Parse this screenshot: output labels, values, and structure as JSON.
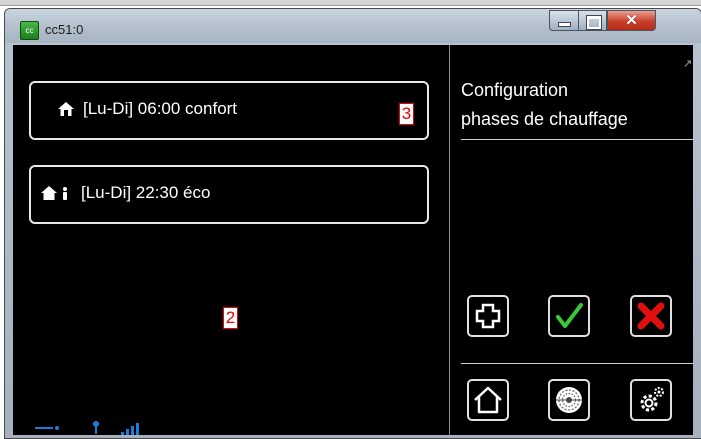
{
  "window": {
    "title": "cc51:0",
    "app_icon_label": "cc",
    "close_glyph": "✕"
  },
  "list": {
    "items": [
      {
        "text": "[Lu-Di] 06:00 confort",
        "icon": "home-icon"
      },
      {
        "text": "[Lu-Di] 22:30 éco",
        "icon": "home-person-icon"
      }
    ]
  },
  "markers": {
    "three": "3",
    "two": "2"
  },
  "sidebar": {
    "title_line1": "Configuration",
    "title_line2": "phases de chauffage",
    "resize_glyph": "↗"
  },
  "status": {
    "signal_glyph": "•ıl"
  },
  "colors": {
    "ok_green": "#3ac83a",
    "delete_red": "#e01010",
    "screen_bg": "#000000"
  }
}
